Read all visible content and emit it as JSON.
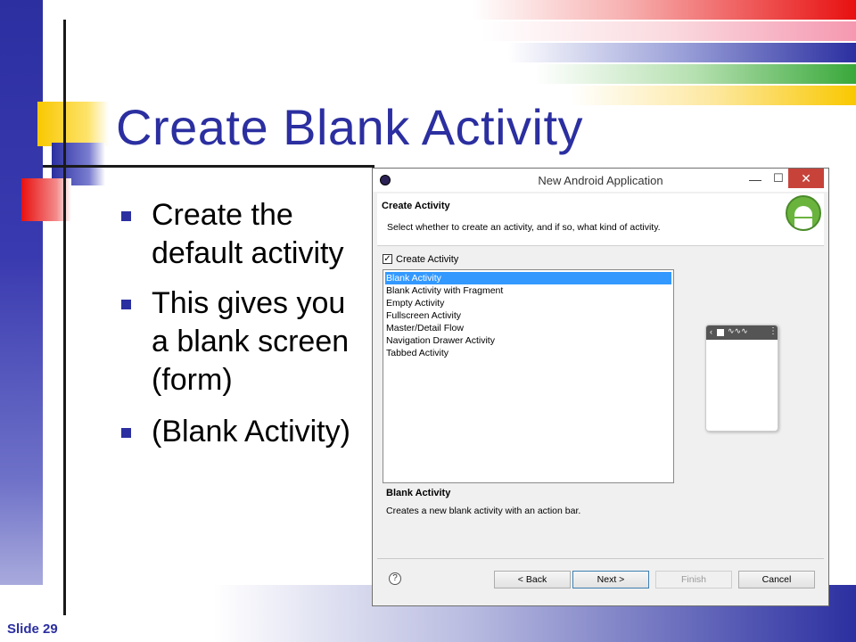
{
  "slide": {
    "title": "Create Blank Activity",
    "bullets": [
      {
        "lines": [
          "Create the",
          "default activity"
        ]
      },
      {
        "lines": [
          "This gives you",
          "a blank screen",
          "(form)"
        ]
      },
      {
        "lines": [
          "(Blank Activity)"
        ]
      }
    ],
    "slide_number": "Slide 29"
  },
  "colors": {
    "title_blue": "#2b2fa0",
    "accent_red": "#e81010",
    "accent_yellow": "#f9c800",
    "accent_green": "#39a83a",
    "selection_blue": "#3399ff",
    "close_red": "#c7433a"
  },
  "dialog": {
    "window_title": "New Android Application",
    "icons": {
      "app": "eclipse-icon",
      "minimize": "minimize-icon",
      "maximize": "maximize-icon",
      "close": "close-icon",
      "logo": "android-logo",
      "help": "help-icon"
    },
    "minimize_glyph": "—",
    "maximize_glyph": "☐",
    "close_glyph": "✕",
    "header_title": "Create Activity",
    "header_description": "Select whether to create an activity, and if so, what kind of activity.",
    "checkbox_label": "Create Activity",
    "checkbox_checked": true,
    "checkbox_glyph": "✓",
    "activity_types": [
      "Blank Activity",
      "Blank Activity with Fragment",
      "Empty Activity",
      "Fullscreen Activity",
      "Master/Detail Flow",
      "Navigation Drawer Activity",
      "Tabbed Activity"
    ],
    "selected_index": 0,
    "selected_title": "Blank Activity",
    "selected_description": "Creates a new blank activity with an action bar.",
    "help_glyph": "?",
    "buttons": {
      "back": "< Back",
      "next": "Next >",
      "finish": "Finish",
      "cancel": "Cancel"
    }
  }
}
